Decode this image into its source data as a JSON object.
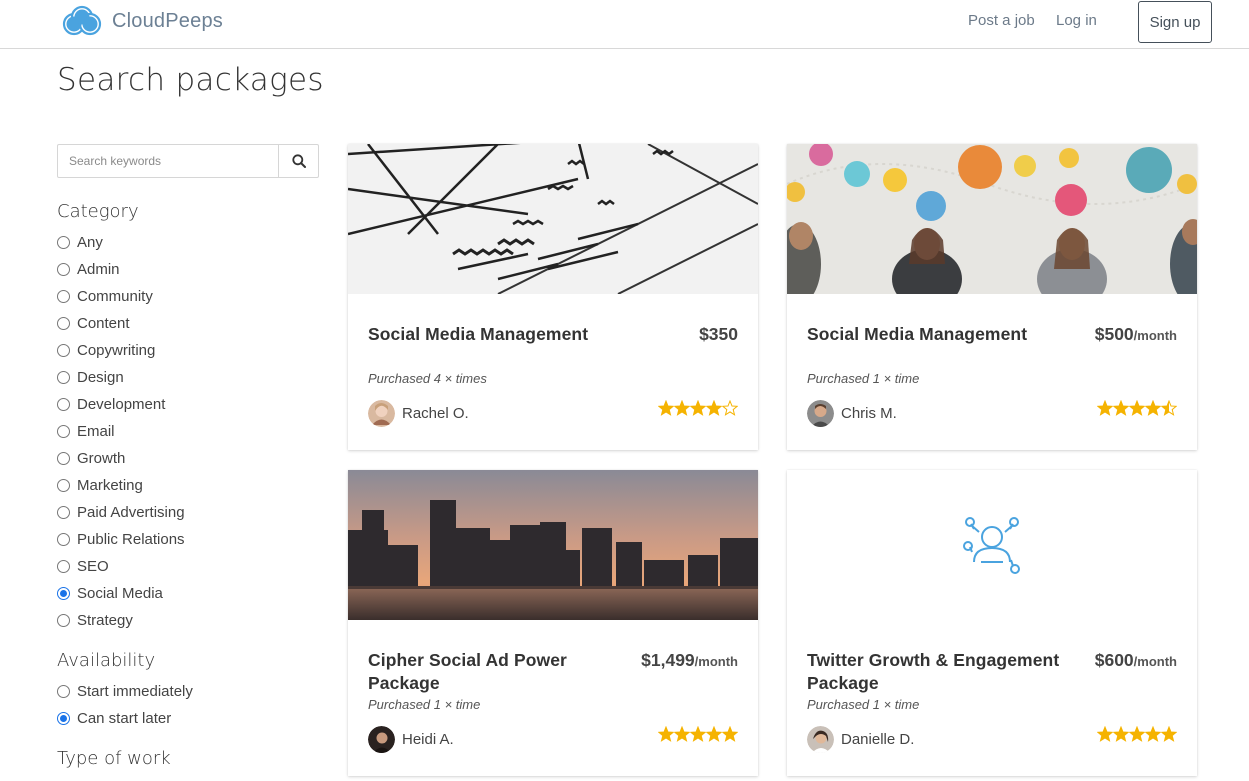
{
  "header": {
    "brand": "CloudPeeps",
    "post_job": "Post a job",
    "log_in": "Log in",
    "sign_up": "Sign up"
  },
  "page": {
    "title": "Search packages"
  },
  "search": {
    "placeholder": "Search keywords"
  },
  "filters": {
    "category_title": "Category",
    "categories": [
      "Any",
      "Admin",
      "Community",
      "Content",
      "Copywriting",
      "Design",
      "Development",
      "Email",
      "Growth",
      "Marketing",
      "Paid Advertising",
      "Public Relations",
      "SEO",
      "Social Media",
      "Strategy"
    ],
    "category_selected": "Social Media",
    "availability_title": "Availability",
    "availability": [
      "Start immediately",
      "Can start later"
    ],
    "availability_selected": "Can start later",
    "type_title": "Type of work"
  },
  "cards": [
    {
      "title": "Social Media Management",
      "price": "$350",
      "per": "",
      "purchased": "Purchased 4 × times",
      "seller": "Rachel O.",
      "rating": 4,
      "image": "wireframe-sketch"
    },
    {
      "title": "Social Media Management",
      "price": "$500",
      "per": "/month",
      "purchased": "Purchased 1 × time",
      "seller": "Chris M.",
      "rating": 4.5,
      "image": "social-icons-people"
    },
    {
      "title": "Cipher Social Ad Power Package",
      "price": "$1,499",
      "per": "/month",
      "purchased": "Purchased 1 × time",
      "seller": "Heidi A.",
      "rating": 5,
      "image": "city-skyline-sunset"
    },
    {
      "title": "Twitter Growth & Engagement Package",
      "price": "$600",
      "per": "/month",
      "purchased": "Purchased 1 × time",
      "seller": "Danielle D.",
      "rating": 5,
      "image": "network-person-icon"
    }
  ],
  "colors": {
    "accent": "#1a73e8",
    "star": "#f5b301",
    "logo_blue": "#4aa3df"
  }
}
